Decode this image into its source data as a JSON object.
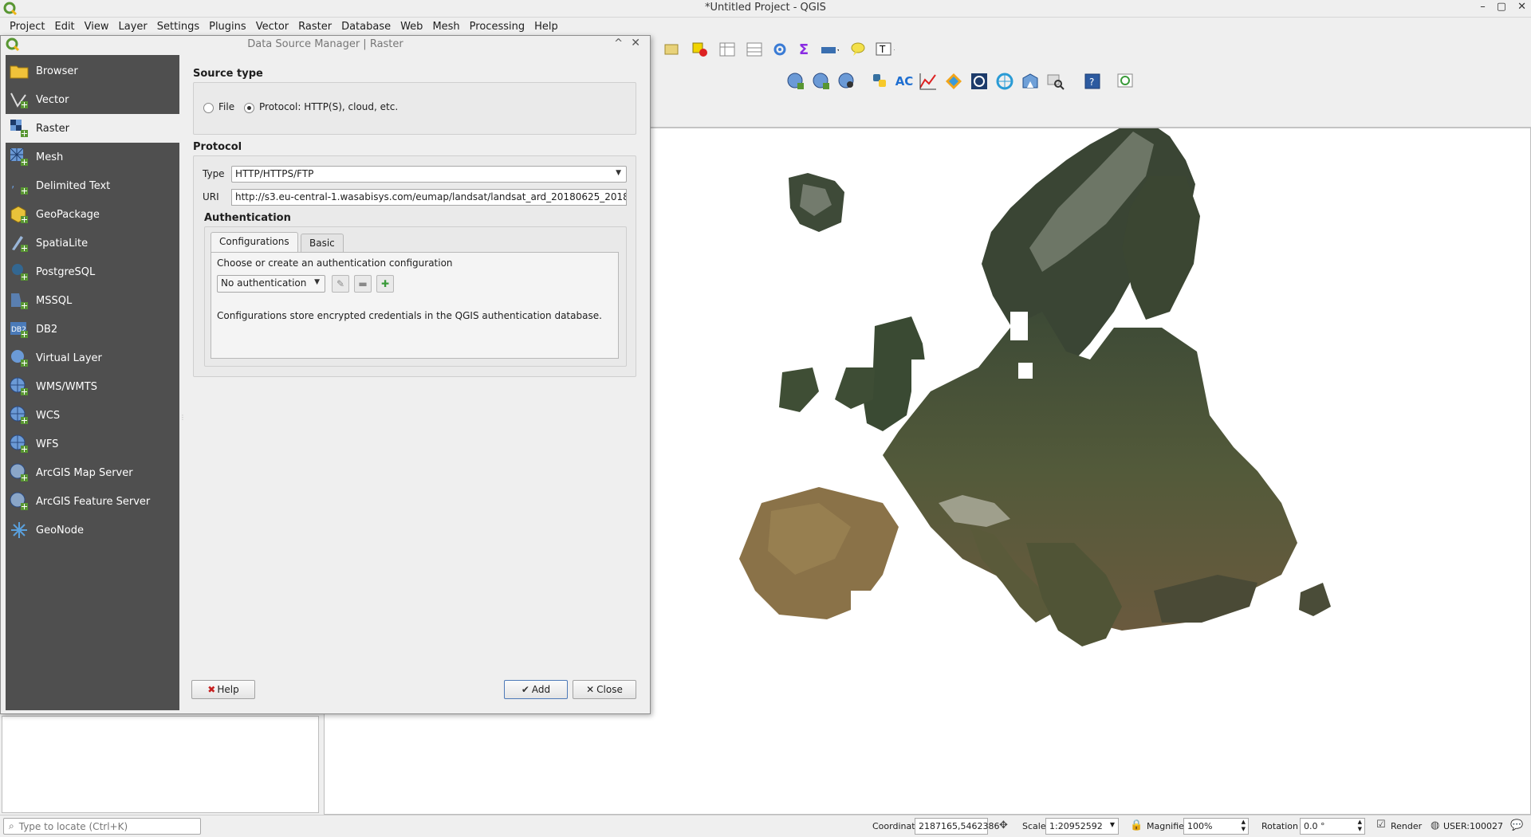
{
  "window": {
    "title": "*Untitled Project - QGIS",
    "controls": [
      "–",
      "▢",
      "✕"
    ]
  },
  "menubar": [
    "Project",
    "Edit",
    "View",
    "Layer",
    "Settings",
    "Plugins",
    "Vector",
    "Raster",
    "Database",
    "Web",
    "Mesh",
    "Processing",
    "Help"
  ],
  "dialog": {
    "title": "Data Source Manager | Raster",
    "nav": [
      {
        "label": "Browser",
        "icon": "folder-icon"
      },
      {
        "label": "Vector",
        "icon": "vector-icon"
      },
      {
        "label": "Raster",
        "icon": "raster-icon",
        "active": true
      },
      {
        "label": "Mesh",
        "icon": "mesh-icon"
      },
      {
        "label": "Delimited Text",
        "icon": "delimited-text-icon"
      },
      {
        "label": "GeoPackage",
        "icon": "geopackage-icon"
      },
      {
        "label": "SpatiaLite",
        "icon": "spatialite-icon"
      },
      {
        "label": "PostgreSQL",
        "icon": "postgresql-icon"
      },
      {
        "label": "MSSQL",
        "icon": "mssql-icon"
      },
      {
        "label": "DB2",
        "icon": "db2-icon"
      },
      {
        "label": "Virtual Layer",
        "icon": "virtual-layer-icon"
      },
      {
        "label": "WMS/WMTS",
        "icon": "wms-icon"
      },
      {
        "label": "WCS",
        "icon": "wcs-icon"
      },
      {
        "label": "WFS",
        "icon": "wfs-icon"
      },
      {
        "label": "ArcGIS Map Server",
        "icon": "arcgis-map-server-icon"
      },
      {
        "label": "ArcGIS Feature Server",
        "icon": "arcgis-feature-server-icon"
      },
      {
        "label": "GeoNode",
        "icon": "geonode-icon"
      }
    ],
    "source_type": {
      "title": "Source type",
      "file_label": "File",
      "protocol_label": "Protocol: HTTP(S), cloud, etc.",
      "selected": "protocol"
    },
    "protocol": {
      "title": "Protocol",
      "type_label": "Type",
      "type_value": "HTTP/HTTPS/FTP",
      "uri_label": "URI",
      "uri_value": "http://s3.eu-central-1.wasabisys.com/eumap/landsat/landsat_ard_20180625_2018"
    },
    "authentication": {
      "title": "Authentication",
      "tabs": [
        "Configurations",
        "Basic"
      ],
      "active_tab": "Configurations",
      "prompt": "Choose or create an authentication configuration",
      "config_value": "No authentication",
      "info": "Configurations store encrypted credentials in the QGIS authentication database."
    },
    "buttons": {
      "help": "Help",
      "add": "Add",
      "close": "Close"
    }
  },
  "statusbar": {
    "locator_placeholder": "Type to locate (Ctrl+K)",
    "coordinate_label": "Coordinate",
    "coordinate_value": "2187165,5462386",
    "scale_label": "Scale",
    "scale_value": "1:20952592",
    "magnifier_label": "Magnifier",
    "magnifier_value": "100%",
    "rotation_label": "Rotation",
    "rotation_value": "0.0 °",
    "render_label": "Render",
    "crs_label": "USER:100027"
  },
  "colors": {
    "nav_bg": "#4f4f4f",
    "qgis_green": "#589632",
    "qgis_yellow": "#eeb518",
    "default_button_border": "#4e7ab8"
  }
}
